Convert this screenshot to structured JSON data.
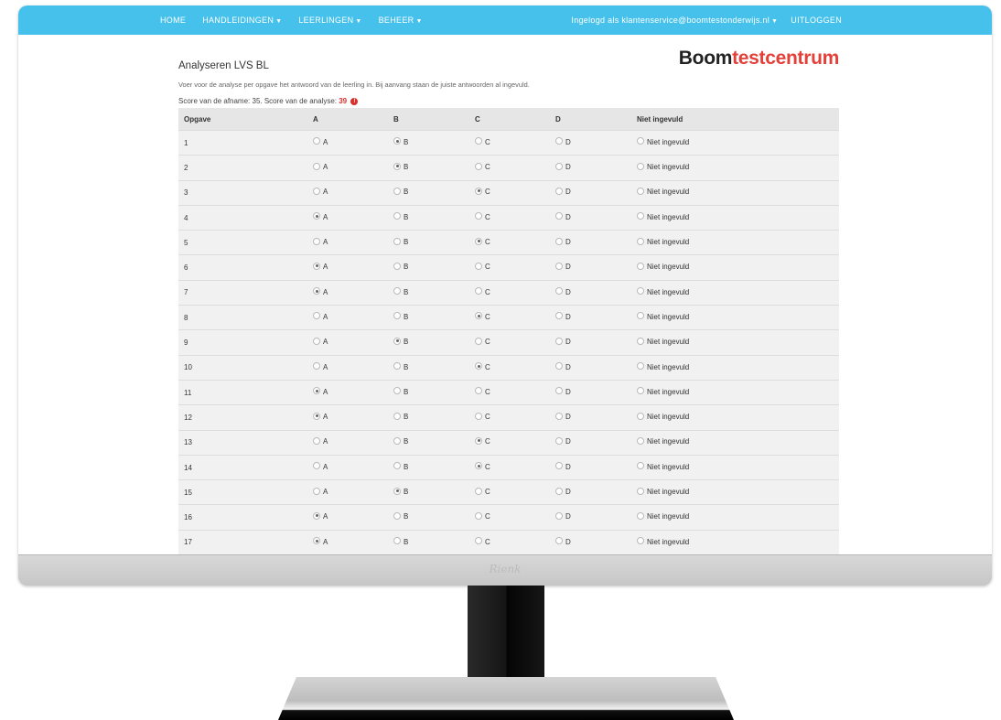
{
  "navbar": {
    "items": [
      {
        "label": "HOME",
        "dropdown": false
      },
      {
        "label": "HANDLEIDINGEN",
        "dropdown": true
      },
      {
        "label": "LEERLINGEN",
        "dropdown": true
      },
      {
        "label": "BEHEER",
        "dropdown": true
      }
    ],
    "user_label": "Ingelogd als klantenservice@boomtestonderwijs.nl",
    "logout_label": "UITLOGGEN",
    "color": "#45c1ec"
  },
  "brand": {
    "part1": "Boom",
    "part2": "testcentrum",
    "accent": "#e3403a"
  },
  "page": {
    "title": "Analyseren LVS BL",
    "instructions": "Voer voor de analyse per opgave het antwoord van de leerling in. Bij aanvang staan de juiste antwoorden al ingevuld.",
    "score_prefix": "Score van de afname: 35. Score van de analyse:",
    "analysis_score": "39"
  },
  "table": {
    "headers": [
      "Opgave",
      "A",
      "B",
      "C",
      "D",
      "Niet ingevuld"
    ],
    "option_labels": [
      "A",
      "B",
      "C",
      "D",
      "Niet ingevuld"
    ],
    "rows": [
      {
        "q": "1",
        "selected": "B"
      },
      {
        "q": "2",
        "selected": "B"
      },
      {
        "q": "3",
        "selected": "C"
      },
      {
        "q": "4",
        "selected": "A"
      },
      {
        "q": "5",
        "selected": "C"
      },
      {
        "q": "6",
        "selected": "A"
      },
      {
        "q": "7",
        "selected": "A"
      },
      {
        "q": "8",
        "selected": "C"
      },
      {
        "q": "9",
        "selected": "B"
      },
      {
        "q": "10",
        "selected": "C"
      },
      {
        "q": "11",
        "selected": "A"
      },
      {
        "q": "12",
        "selected": "A"
      },
      {
        "q": "13",
        "selected": "C"
      },
      {
        "q": "14",
        "selected": "C"
      },
      {
        "q": "15",
        "selected": "B"
      },
      {
        "q": "16",
        "selected": "A"
      },
      {
        "q": "17",
        "selected": "A"
      }
    ]
  },
  "monitor": {
    "logo": "Rienk"
  }
}
